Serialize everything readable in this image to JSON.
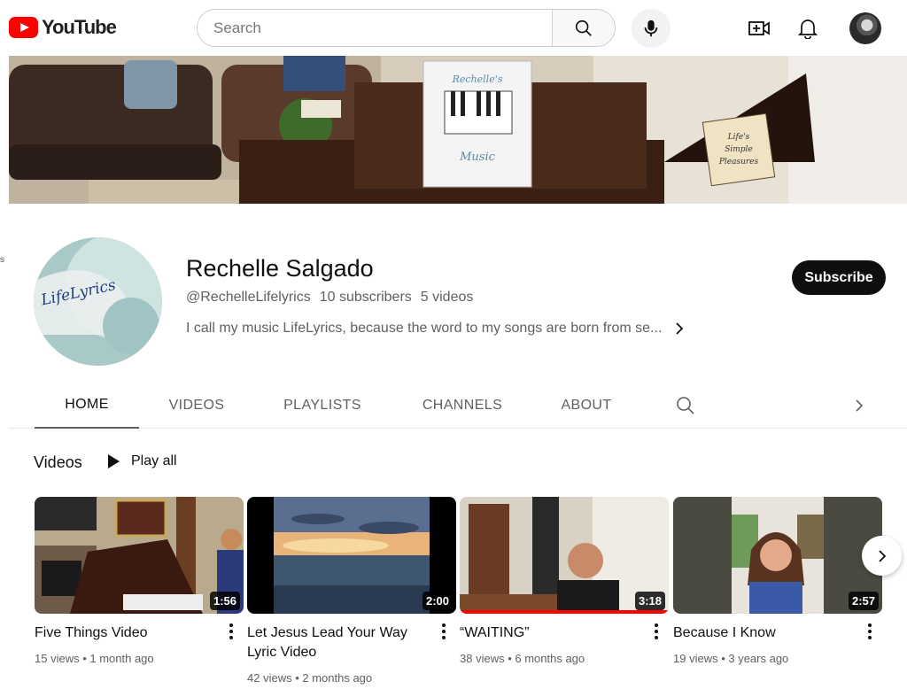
{
  "header": {
    "logo_text": "YouTube",
    "search_placeholder": "Search"
  },
  "channel": {
    "left_edge_glyph": "s",
    "avatar_text": "LifeLyrics",
    "name": "Rechelle Salgado",
    "handle": "@RechelleLifelyrics",
    "subscribers": "10 subscribers",
    "video_count": "5 videos",
    "description": "I call my music LifeLyrics, because the word to my songs are born from se...",
    "subscribe_label": "Subscribe"
  },
  "banner": {
    "book_title_top": "Rechelle's",
    "book_title_bottom": "Music",
    "sign_text": [
      "Life's",
      "Simple",
      "Pleasures"
    ]
  },
  "tabs": [
    "HOME",
    "VIDEOS",
    "PLAYLISTS",
    "CHANNELS",
    "ABOUT"
  ],
  "section": {
    "title": "Videos",
    "play_all": "Play all"
  },
  "videos": [
    {
      "title": "Five Things Video",
      "views": "15 views",
      "age": "1 month ago",
      "duration": "1:56",
      "progress": 0
    },
    {
      "title": "Let Jesus Lead Your Way Lyric Video",
      "views": "42 views",
      "age": "2 months ago",
      "duration": "2:00",
      "progress": 0
    },
    {
      "title": "“WAITING”",
      "views": "38 views",
      "age": "6 months ago",
      "duration": "3:18",
      "progress": 1.0
    },
    {
      "title": "Because I Know",
      "views": "19 views",
      "age": "3 years ago",
      "duration": "2:57",
      "progress": 0
    }
  ],
  "colors": {
    "brand_red": "#ff0000",
    "subscribe_bg": "#0f0f0f",
    "meta_gray": "#606060"
  }
}
